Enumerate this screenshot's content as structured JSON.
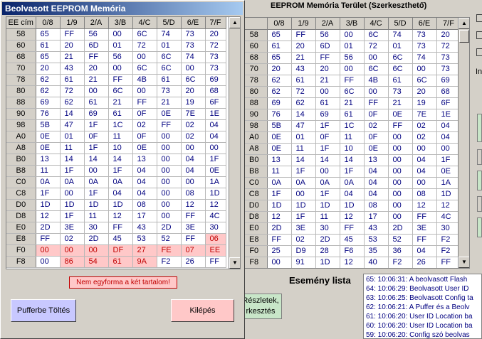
{
  "main": {
    "header_title": "EEPROM Memória Terület (Szerkeszthető)",
    "columns": [
      "",
      "0/8",
      "1/9",
      "2/A",
      "3/B",
      "4/C",
      "5/D",
      "6/E",
      "7/F"
    ],
    "rows": [
      [
        "58",
        "65",
        "FF",
        "56",
        "00",
        "6C",
        "74",
        "73",
        "20"
      ],
      [
        "60",
        "61",
        "20",
        "6D",
        "01",
        "72",
        "01",
        "73",
        "72"
      ],
      [
        "68",
        "65",
        "21",
        "FF",
        "56",
        "00",
        "6C",
        "74",
        "73"
      ],
      [
        "70",
        "20",
        "43",
        "20",
        "00",
        "6C",
        "6C",
        "00",
        "73"
      ],
      [
        "78",
        "62",
        "61",
        "21",
        "FF",
        "4B",
        "61",
        "6C",
        "69"
      ],
      [
        "80",
        "62",
        "72",
        "00",
        "6C",
        "00",
        "73",
        "20",
        "68"
      ],
      [
        "88",
        "69",
        "62",
        "61",
        "21",
        "FF",
        "21",
        "19",
        "6F"
      ],
      [
        "90",
        "76",
        "14",
        "69",
        "61",
        "0F",
        "0E",
        "7E",
        "1E"
      ],
      [
        "98",
        "5B",
        "47",
        "1F",
        "1C",
        "02",
        "FF",
        "02",
        "04"
      ],
      [
        "A0",
        "0E",
        "01",
        "0F",
        "11",
        "0F",
        "00",
        "02",
        "04"
      ],
      [
        "A8",
        "0E",
        "11",
        "1F",
        "10",
        "0E",
        "00",
        "00",
        "00"
      ],
      [
        "B0",
        "13",
        "14",
        "14",
        "14",
        "13",
        "00",
        "04",
        "1F"
      ],
      [
        "B8",
        "11",
        "1F",
        "00",
        "1F",
        "04",
        "00",
        "04",
        "0E"
      ],
      [
        "C0",
        "0A",
        "0A",
        "0A",
        "0A",
        "04",
        "00",
        "00",
        "1A"
      ],
      [
        "C8",
        "1F",
        "00",
        "1F",
        "04",
        "04",
        "00",
        "08",
        "1D"
      ],
      [
        "D0",
        "1D",
        "1D",
        "1D",
        "1D",
        "08",
        "00",
        "12",
        "12"
      ],
      [
        "D8",
        "12",
        "1F",
        "11",
        "12",
        "17",
        "00",
        "FF",
        "4C"
      ],
      [
        "E0",
        "2D",
        "3E",
        "30",
        "FF",
        "43",
        "2D",
        "3E",
        "30"
      ],
      [
        "E8",
        "FF",
        "02",
        "2D",
        "45",
        "53",
        "52",
        "FF",
        "F2"
      ],
      [
        "F0",
        "25",
        "D9",
        "28",
        "F6",
        "35",
        "36",
        "04",
        "F2"
      ],
      [
        "F8",
        "00",
        "91",
        "1D",
        "12",
        "40",
        "F2",
        "26",
        "FF"
      ]
    ],
    "event_label": "Esemény lista",
    "events": [
      "65:  10:06:31:  A beolvasott Flash",
      "64:  10:06:29:  Beolvasott User ID",
      "63:  10:06:25:  Beolvasott Config ta",
      "62:  10:06:21:  A Puffer és a Beolv",
      "61:  10:06:20:  User ID Location ba",
      "60:  10:06:20:  User ID Location ba",
      "59:  10:06:20:  Config szó beolvas"
    ],
    "details_button": "Részletek, rkesztés",
    "side_label": "In"
  },
  "dialog": {
    "title": "Beolvasott EEPROM Memória",
    "columns": [
      "EE cím",
      "0/8",
      "1/9",
      "2/A",
      "3/B",
      "4/C",
      "5/D",
      "6/E",
      "7/F"
    ],
    "rows": [
      [
        "58",
        "65",
        "FF",
        "56",
        "00",
        "6C",
        "74",
        "73",
        "20"
      ],
      [
        "60",
        "61",
        "20",
        "6D",
        "01",
        "72",
        "01",
        "73",
        "72"
      ],
      [
        "68",
        "65",
        "21",
        "FF",
        "56",
        "00",
        "6C",
        "74",
        "73"
      ],
      [
        "70",
        "20",
        "43",
        "20",
        "00",
        "6C",
        "6C",
        "00",
        "73"
      ],
      [
        "78",
        "62",
        "61",
        "21",
        "FF",
        "4B",
        "61",
        "6C",
        "69"
      ],
      [
        "80",
        "62",
        "72",
        "00",
        "6C",
        "00",
        "73",
        "20",
        "68"
      ],
      [
        "88",
        "69",
        "62",
        "61",
        "21",
        "FF",
        "21",
        "19",
        "6F"
      ],
      [
        "90",
        "76",
        "14",
        "69",
        "61",
        "0F",
        "0E",
        "7E",
        "1E"
      ],
      [
        "98",
        "5B",
        "47",
        "1F",
        "1C",
        "02",
        "FF",
        "02",
        "04"
      ],
      [
        "A0",
        "0E",
        "01",
        "0F",
        "11",
        "0F",
        "00",
        "02",
        "04"
      ],
      [
        "A8",
        "0E",
        "11",
        "1F",
        "10",
        "0E",
        "00",
        "00",
        "00"
      ],
      [
        "B0",
        "13",
        "14",
        "14",
        "14",
        "13",
        "00",
        "04",
        "1F"
      ],
      [
        "B8",
        "11",
        "1F",
        "00",
        "1F",
        "04",
        "00",
        "04",
        "0E"
      ],
      [
        "C0",
        "0A",
        "0A",
        "0A",
        "0A",
        "04",
        "00",
        "00",
        "1A"
      ],
      [
        "C8",
        "1F",
        "00",
        "1F",
        "04",
        "04",
        "00",
        "08",
        "1D"
      ],
      [
        "D0",
        "1D",
        "1D",
        "1D",
        "1D",
        "08",
        "00",
        "12",
        "12"
      ],
      [
        "D8",
        "12",
        "1F",
        "11",
        "12",
        "17",
        "00",
        "FF",
        "4C"
      ],
      [
        "E0",
        "2D",
        "3E",
        "30",
        "FF",
        "43",
        "2D",
        "3E",
        "30"
      ],
      [
        "E8",
        "FF",
        "02",
        "2D",
        "45",
        "53",
        "52",
        "FF",
        "06"
      ],
      [
        "F0",
        "00",
        "00",
        "00",
        "DF",
        "27",
        "FE",
        "07",
        "EE"
      ],
      [
        "F8",
        "00",
        "86",
        "54",
        "61",
        "9A",
        "F2",
        "26",
        "FF"
      ]
    ],
    "diff_cells": [
      [
        18,
        8
      ],
      [
        19,
        1
      ],
      [
        19,
        2
      ],
      [
        19,
        3
      ],
      [
        19,
        4
      ],
      [
        19,
        5
      ],
      [
        19,
        6
      ],
      [
        19,
        7
      ],
      [
        19,
        8
      ],
      [
        20,
        2
      ],
      [
        20,
        3
      ],
      [
        20,
        4
      ],
      [
        20,
        5
      ]
    ],
    "warning": "Nem egyforma a két tartalom!",
    "buffer_button": "Pufferbe Töltés",
    "exit_button": "Kilépés"
  }
}
